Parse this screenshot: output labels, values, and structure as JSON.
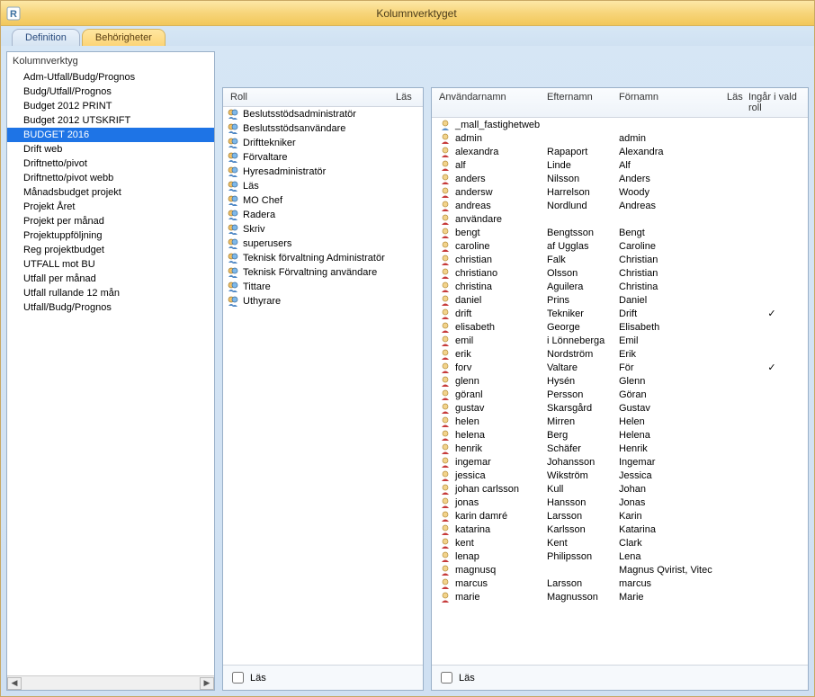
{
  "window": {
    "title": "Kolumnverktyget"
  },
  "tabs": [
    {
      "label": "Definition",
      "active": false
    },
    {
      "label": "Behörigheter",
      "active": true
    }
  ],
  "leftPanel": {
    "header": "Kolumnverktyg",
    "items": [
      "Adm-Utfall/Budg/Prognos",
      "Budg/Utfall/Prognos",
      "Budget 2012 PRINT",
      "Budget 2012 UTSKRIFT",
      "BUDGET 2016",
      "Drift web",
      "Driftnetto/pivot",
      "Driftnetto/pivot webb",
      "Månadsbudget projekt",
      "Projekt Året",
      "Projekt per månad",
      "Projektuppföljning",
      "Reg projektbudget",
      "UTFALL mot BU",
      "Utfall per månad",
      "Utfall rullande 12 mån",
      "Utfall/Budg/Prognos"
    ],
    "selectedIndex": 4
  },
  "rolesPanel": {
    "columns": {
      "roll": "Roll",
      "las": "Läs"
    },
    "roles": [
      {
        "name": "Beslutsstödsadministratör",
        "icon": "multi"
      },
      {
        "name": "Beslutsstödsanvändare",
        "icon": "multi"
      },
      {
        "name": "Drifttekniker",
        "icon": "multi"
      },
      {
        "name": "Förvaltare",
        "icon": "multi"
      },
      {
        "name": "Hyresadministratör",
        "icon": "multi"
      },
      {
        "name": "Läs",
        "icon": "multi"
      },
      {
        "name": "MO Chef",
        "icon": "multi"
      },
      {
        "name": "Radera",
        "icon": "multi"
      },
      {
        "name": "Skriv",
        "icon": "multi"
      },
      {
        "name": "superusers",
        "icon": "multi"
      },
      {
        "name": "Teknisk förvaltning Administratör",
        "icon": "multi"
      },
      {
        "name": "Teknisk Förvaltning användare",
        "icon": "multi"
      },
      {
        "name": "Tittare",
        "icon": "multi"
      },
      {
        "name": "Uthyrare",
        "icon": "multi"
      }
    ],
    "footerLasLabel": "Läs",
    "footerLasChecked": false
  },
  "usersPanel": {
    "columns": {
      "user": "Användarnamn",
      "last": "Efternamn",
      "first": "Förnamn",
      "las": "Läs",
      "ingar": "Ingår i vald roll"
    },
    "users": [
      {
        "username": "_mall_fastighetweb",
        "lastname": "",
        "firstname": "",
        "las": false,
        "ingar": false,
        "icon": "single"
      },
      {
        "username": "admin",
        "lastname": "",
        "firstname": "admin",
        "las": false,
        "ingar": false,
        "icon": "red"
      },
      {
        "username": "alexandra",
        "lastname": "Rapaport",
        "firstname": "Alexandra",
        "las": false,
        "ingar": false,
        "icon": "red"
      },
      {
        "username": "alf",
        "lastname": "Linde",
        "firstname": "Alf",
        "las": false,
        "ingar": false,
        "icon": "red"
      },
      {
        "username": "anders",
        "lastname": "Nilsson",
        "firstname": "Anders",
        "las": false,
        "ingar": false,
        "icon": "red"
      },
      {
        "username": "andersw",
        "lastname": "Harrelson",
        "firstname": "Woody",
        "las": false,
        "ingar": false,
        "icon": "red"
      },
      {
        "username": "andreas",
        "lastname": "Nordlund",
        "firstname": "Andreas",
        "las": false,
        "ingar": false,
        "icon": "red"
      },
      {
        "username": "användare",
        "lastname": "",
        "firstname": "",
        "las": false,
        "ingar": false,
        "icon": "red"
      },
      {
        "username": "bengt",
        "lastname": "Bengtsson",
        "firstname": "Bengt",
        "las": false,
        "ingar": false,
        "icon": "red"
      },
      {
        "username": "caroline",
        "lastname": "af Ugglas",
        "firstname": "Caroline",
        "las": false,
        "ingar": false,
        "icon": "red"
      },
      {
        "username": "christian",
        "lastname": "Falk",
        "firstname": "Christian",
        "las": false,
        "ingar": false,
        "icon": "red"
      },
      {
        "username": "christiano",
        "lastname": "Olsson",
        "firstname": "Christian",
        "las": false,
        "ingar": false,
        "icon": "red"
      },
      {
        "username": "christina",
        "lastname": "Aguilera",
        "firstname": "Christina",
        "las": false,
        "ingar": false,
        "icon": "red"
      },
      {
        "username": "daniel",
        "lastname": "Prins",
        "firstname": "Daniel",
        "las": false,
        "ingar": false,
        "icon": "red"
      },
      {
        "username": "drift",
        "lastname": "Tekniker",
        "firstname": "Drift",
        "las": false,
        "ingar": true,
        "icon": "red"
      },
      {
        "username": "elisabeth",
        "lastname": "George",
        "firstname": "Elisabeth",
        "las": false,
        "ingar": false,
        "icon": "red"
      },
      {
        "username": "emil",
        "lastname": "i Lönneberga",
        "firstname": "Emil",
        "las": false,
        "ingar": false,
        "icon": "red"
      },
      {
        "username": "erik",
        "lastname": "Nordström",
        "firstname": "Erik",
        "las": false,
        "ingar": false,
        "icon": "red"
      },
      {
        "username": "forv",
        "lastname": "Valtare",
        "firstname": "För",
        "las": false,
        "ingar": true,
        "icon": "red"
      },
      {
        "username": "glenn",
        "lastname": "Hysén",
        "firstname": "Glenn",
        "las": false,
        "ingar": false,
        "icon": "red"
      },
      {
        "username": "göranl",
        "lastname": "Persson",
        "firstname": "Göran",
        "las": false,
        "ingar": false,
        "icon": "red"
      },
      {
        "username": "gustav",
        "lastname": "Skarsgård",
        "firstname": "Gustav",
        "las": false,
        "ingar": false,
        "icon": "red"
      },
      {
        "username": "helen",
        "lastname": "Mirren",
        "firstname": "Helen",
        "las": false,
        "ingar": false,
        "icon": "red"
      },
      {
        "username": "helena",
        "lastname": "Berg",
        "firstname": "Helena",
        "las": false,
        "ingar": false,
        "icon": "red"
      },
      {
        "username": "henrik",
        "lastname": "Schäfer",
        "firstname": "Henrik",
        "las": false,
        "ingar": false,
        "icon": "red"
      },
      {
        "username": "ingemar",
        "lastname": "Johansson",
        "firstname": "Ingemar",
        "las": false,
        "ingar": false,
        "icon": "red"
      },
      {
        "username": "jessica",
        "lastname": "Wikström",
        "firstname": "Jessica",
        "las": false,
        "ingar": false,
        "icon": "red"
      },
      {
        "username": "johan carlsson",
        "lastname": "Kull",
        "firstname": "Johan",
        "las": false,
        "ingar": false,
        "icon": "red"
      },
      {
        "username": "jonas",
        "lastname": "Hansson",
        "firstname": "Jonas",
        "las": false,
        "ingar": false,
        "icon": "red"
      },
      {
        "username": "karin damré",
        "lastname": "Larsson",
        "firstname": "Karin",
        "las": false,
        "ingar": false,
        "icon": "red"
      },
      {
        "username": "katarina",
        "lastname": "Karlsson",
        "firstname": "Katarina",
        "las": false,
        "ingar": false,
        "icon": "red"
      },
      {
        "username": "kent",
        "lastname": "Kent",
        "firstname": "Clark",
        "las": false,
        "ingar": false,
        "icon": "red"
      },
      {
        "username": "lenap",
        "lastname": "Philipsson",
        "firstname": "Lena",
        "las": false,
        "ingar": false,
        "icon": "red"
      },
      {
        "username": "magnusq",
        "lastname": "",
        "firstname": "Magnus Qvirist, Vitec",
        "las": false,
        "ingar": false,
        "icon": "red"
      },
      {
        "username": "marcus",
        "lastname": "Larsson",
        "firstname": "marcus",
        "las": false,
        "ingar": false,
        "icon": "red"
      },
      {
        "username": "marie",
        "lastname": "Magnusson",
        "firstname": "Marie",
        "las": false,
        "ingar": false,
        "icon": "red"
      }
    ],
    "footerLasLabel": "Läs",
    "footerLasChecked": false
  }
}
